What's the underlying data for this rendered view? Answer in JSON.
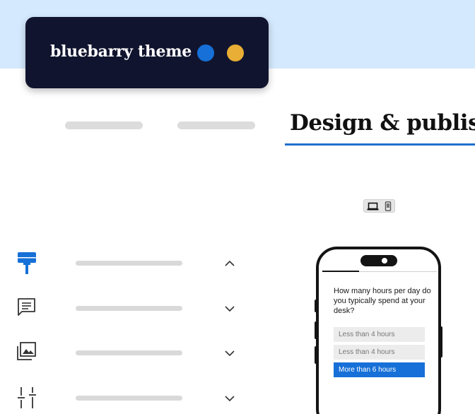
{
  "theme": {
    "title": "bluebarry theme",
    "colors": {
      "primary": "#1670d8",
      "accent": "#e8ae35",
      "card_bg": "#11142e",
      "band_bg": "#d4e9fd"
    }
  },
  "tabs": {
    "active_label": "Design & publish"
  },
  "device_toggle": {
    "options": [
      "laptop-icon",
      "phone-icon"
    ]
  },
  "tools": [
    {
      "icon": "paint-roller-icon",
      "state": "expanded",
      "active": true
    },
    {
      "icon": "message-icon",
      "state": "collapsed",
      "active": false
    },
    {
      "icon": "image-gallery-icon",
      "state": "collapsed",
      "active": false
    },
    {
      "icon": "sliders-icon",
      "state": "collapsed",
      "active": false
    }
  ],
  "preview": {
    "question": "How many hours per day do you typically spend at your desk?",
    "options": [
      {
        "label": "Less than 4 hours",
        "selected": false
      },
      {
        "label": "Less than 4 hours",
        "selected": false
      },
      {
        "label": "More than 6 hours",
        "selected": true
      }
    ]
  }
}
